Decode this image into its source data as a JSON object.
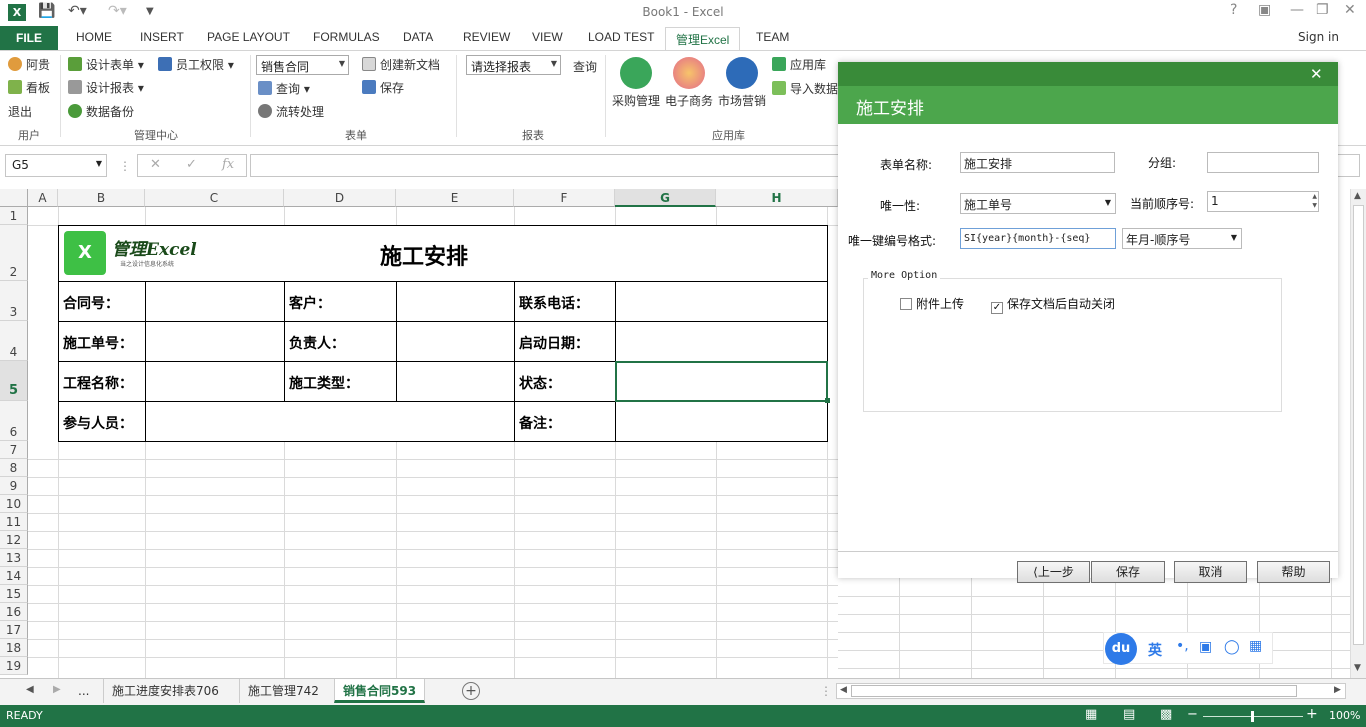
{
  "app": {
    "title": "Book1 - Excel",
    "signin": "Sign in"
  },
  "tabs": [
    "FILE",
    "HOME",
    "INSERT",
    "PAGE LAYOUT",
    "FORMULAS",
    "DATA",
    "REVIEW",
    "VIEW",
    "LOAD TEST",
    "管理Excel",
    "TEAM"
  ],
  "ribbon": {
    "user": {
      "b1": "阿贵",
      "b2": "看板",
      "b3": "退出",
      "group": "用户"
    },
    "mgmt": {
      "b1": "设计表单",
      "b2": "员工权限",
      "b3": "设计报表",
      "b4": "数据备份",
      "group": "管理中心"
    },
    "form": {
      "combo": "销售合同",
      "b1": "查询",
      "b2": "流转处理",
      "b3": "创建新文档",
      "b4": "保存",
      "group": "表单"
    },
    "report": {
      "combo": "请选择报表",
      "b1": "查询",
      "group": "报表"
    },
    "apps": {
      "b1": "采购管理",
      "b2": "电子商务",
      "b3": "市场营销",
      "b4": "应用库",
      "b5": "导入数据",
      "group": "应用库"
    }
  },
  "formula_bar": {
    "namebox": "G5",
    "fx": "fx"
  },
  "columns": [
    "A",
    "B",
    "C",
    "D",
    "E",
    "F",
    "G",
    "H"
  ],
  "rows": [
    "1",
    "2",
    "3",
    "4",
    "5",
    "6",
    "7",
    "8",
    "9",
    "10",
    "11",
    "12",
    "13",
    "14",
    "15",
    "16",
    "17",
    "18",
    "19"
  ],
  "sheet": {
    "logo_text": "管理Excel",
    "logo_sub": "当之设计信息化系统",
    "title": "施工安排",
    "labels": {
      "contract": "合同号：",
      "customer": "客户：",
      "phone": "联系电话：",
      "order": "施工单号：",
      "owner": "负责人：",
      "start": "启动日期：",
      "project": "工程名称：",
      "type": "施工类型：",
      "status": "状态：",
      "members": "参与人员：",
      "note": "备注："
    }
  },
  "dialog": {
    "title": "施工安排",
    "form_name_label": "表单名称:",
    "form_name": "施工安排",
    "group_label": "分组:",
    "group": "",
    "unique_label": "唯一性:",
    "unique": "施工单号",
    "seq_label": "当前顺序号:",
    "seq": "1",
    "format_label": "唯一键编号格式:",
    "format": "SI{year}{month}-{seq}",
    "format_combo": "年月-顺序号",
    "more_option": "More Option",
    "opt1": "附件上传",
    "opt2": "保存文档后自动关闭",
    "buttons": {
      "prev": "上一步",
      "save": "保存",
      "cancel": "取消",
      "help": "帮助"
    }
  },
  "sheet_tabs": [
    "...",
    "施工进度安排表706",
    "施工管理742",
    "销售合同593"
  ],
  "status": {
    "ready": "READY",
    "zoom": "100%"
  },
  "colors": {
    "excel_green": "#217346",
    "dialog_green": "#4ca64c"
  }
}
